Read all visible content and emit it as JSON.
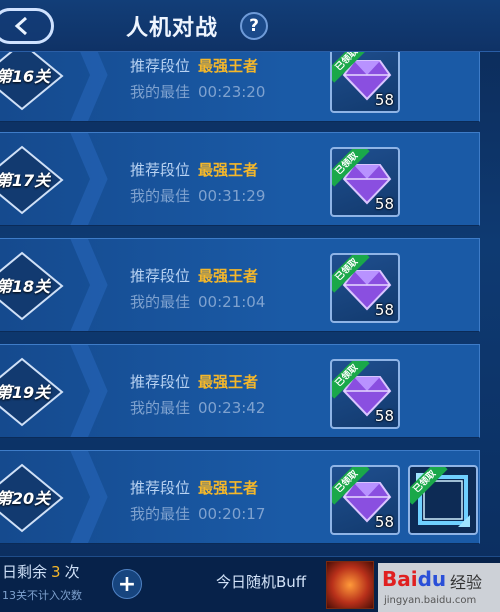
{
  "header": {
    "title": "人机对战",
    "help_label": "?"
  },
  "levels": [
    {
      "label": "第16关",
      "rec_label": "推荐段位",
      "rec_value": "最强王者",
      "best_label": "我的最佳",
      "best_time": "00:23:20",
      "claimed": "已领取",
      "qty": "58"
    },
    {
      "label": "第17关",
      "rec_label": "推荐段位",
      "rec_value": "最强王者",
      "best_label": "我的最佳",
      "best_time": "00:31:29",
      "claimed": "已领取",
      "qty": "58"
    },
    {
      "label": "第18关",
      "rec_label": "推荐段位",
      "rec_value": "最强王者",
      "best_label": "我的最佳",
      "best_time": "00:21:04",
      "claimed": "已领取",
      "qty": "58"
    },
    {
      "label": "第19关",
      "rec_label": "推荐段位",
      "rec_value": "最强王者",
      "best_label": "我的最佳",
      "best_time": "00:23:42",
      "claimed": "已领取",
      "qty": "58"
    },
    {
      "label": "第20关",
      "rec_label": "推荐段位",
      "rec_value": "最强王者",
      "best_label": "我的最佳",
      "best_time": "00:20:17",
      "claimed": "已领取",
      "qty": "58",
      "extra_claimed": "已领取"
    }
  ],
  "bottom": {
    "remaining_prefix": "日剩余",
    "remaining_count": "3",
    "remaining_suffix": "次",
    "note": "13关不计入次数",
    "plus_label": "+",
    "buff_label": "今日随机Buff"
  },
  "watermark": {
    "brand_bai": "Bai",
    "brand_du": "du",
    "text": "经验",
    "url": "jingyan.baidu.com"
  },
  "colors": {
    "accent_gold": "#f4b72a",
    "claimed_green": "#1aa84a",
    "gem_purple": "#8a4fe0"
  }
}
